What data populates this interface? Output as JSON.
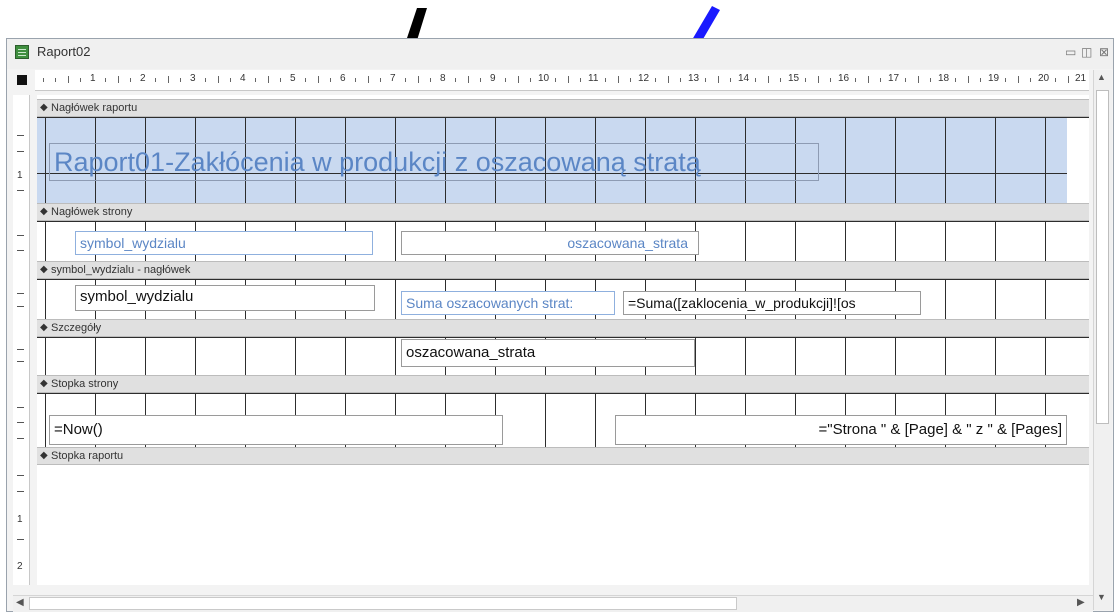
{
  "window": {
    "title": "Raport02",
    "controls": {
      "minimize": "▭",
      "maximize": "◫",
      "close": "⊠"
    }
  },
  "ruler": {
    "numbers": [
      "1",
      "2",
      "3",
      "4",
      "5",
      "6",
      "7",
      "8",
      "9",
      "10",
      "11",
      "12",
      "13",
      "14",
      "15",
      "16",
      "17",
      "18",
      "19",
      "20",
      "21"
    ],
    "vertical_numbers": [
      "1",
      "1",
      "2"
    ]
  },
  "sections": {
    "report_header": {
      "label": "Nagłówek raportu",
      "title_control": "Raport01-Zakłócenia w produkcji z oszacowaną stratą"
    },
    "page_header": {
      "label": "Nagłówek strony",
      "label_symbol": "symbol_wydzialu",
      "label_loss": "oszacowana_strata"
    },
    "group_header": {
      "label": "symbol_wydzialu - nagłówek",
      "field_symbol": "symbol_wydzialu",
      "sum_label": "Suma oszacowanych strat:",
      "sum_expr": "=Suma([zaklocenia_w_produkcji]![os"
    },
    "detail": {
      "label": "Szczegóły",
      "field_loss": "oszacowana_strata"
    },
    "page_footer": {
      "label": "Stopka strony",
      "now_expr": "=Now()",
      "page_expr": "=\"Strona \" & [Page] & \" z \" & [Pages]"
    },
    "report_footer": {
      "label": "Stopka raportu"
    }
  },
  "arrows": {
    "black_color": "#000000",
    "blue_color": "#1a1aff"
  },
  "icons": {
    "section_arrow": "section-collapse-arrow-icon",
    "app": "report-icon"
  }
}
